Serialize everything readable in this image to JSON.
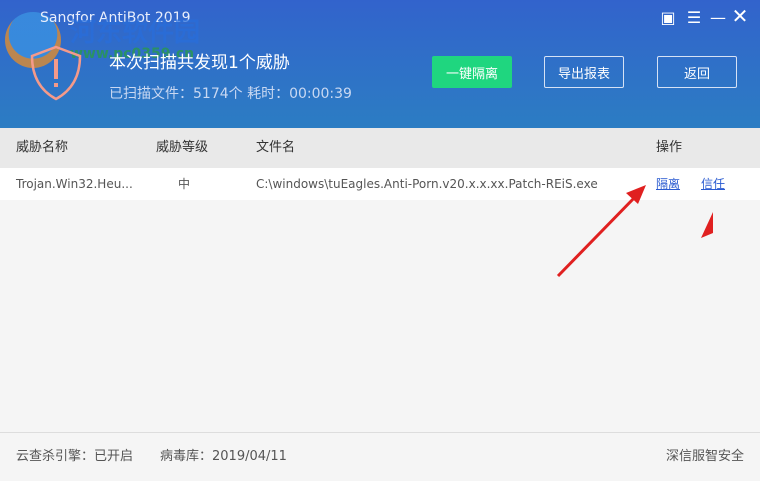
{
  "window": {
    "title": "Sangfor AntiBot 2019"
  },
  "watermark": {
    "name": "河东软件园",
    "url": "www.pc0359.cn"
  },
  "summary": {
    "headline": "本次扫描共发现1个威胁",
    "stats": "已扫描文件：5174个 耗时：00:00:39"
  },
  "buttons": {
    "quarantine_all": "一键隔离",
    "export": "导出报表",
    "back": "返回"
  },
  "table": {
    "columns": [
      "威胁名称",
      "威胁等级",
      "文件名",
      "操作"
    ],
    "rows": [
      {
        "name": "Trojan.Win32.Heu...",
        "level": "中",
        "file": "C:\\windows\\tuEagles.Anti-Porn.v20.x.x.xx.Patch-REiS.exe",
        "action_quarantine": "隔离",
        "action_trust": "信任"
      }
    ]
  },
  "footer": {
    "cloud": "云查杀引擎：已开启",
    "virus_db": "病毒库：2019/04/11",
    "brand": "深信服智安全"
  },
  "colors": {
    "accent": "#1fd67f",
    "header": "#3263cc",
    "link": "#2a5bd0",
    "annotation": "#e02020"
  }
}
